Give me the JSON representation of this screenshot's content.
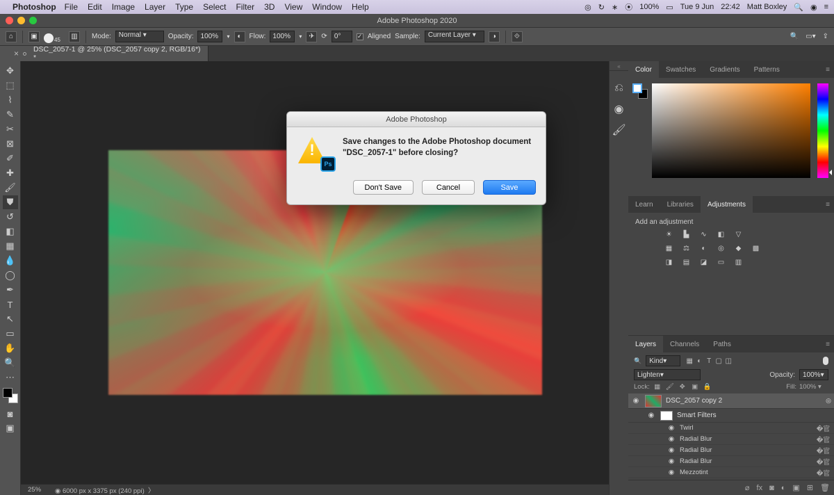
{
  "menubar": {
    "app_name": "Photoshop",
    "items": [
      "File",
      "Edit",
      "Image",
      "Layer",
      "Type",
      "Select",
      "Filter",
      "3D",
      "View",
      "Window",
      "Help"
    ],
    "status": {
      "battery": "100%",
      "date": "Tue 9 Jun",
      "time": "22:42",
      "user": "Matt Boxley"
    }
  },
  "window_title": "Adobe Photoshop 2020",
  "options": {
    "brush_size": "45",
    "mode_label": "Mode:",
    "mode": "Normal",
    "opacity_label": "Opacity:",
    "opacity": "100%",
    "flow_label": "Flow:",
    "flow": "100%",
    "angle_icon": "⟳",
    "angle": "0°",
    "aligned_label": "Aligned",
    "sample_label": "Sample:",
    "sample": "Current Layer"
  },
  "doc_tab": "DSC_2057-1 @ 25% (DSC_2057 copy 2, RGB/16*) *",
  "statusbar": {
    "zoom": "25%",
    "info": "6000 px x 3375 px (240 ppi)"
  },
  "panels": {
    "color_tabs": [
      "Color",
      "Swatches",
      "Gradients",
      "Patterns"
    ],
    "adjust_tabs": [
      "Learn",
      "Libraries",
      "Adjustments"
    ],
    "adjust_hint": "Add an adjustment",
    "layers_tabs": [
      "Layers",
      "Channels",
      "Paths"
    ]
  },
  "layers": {
    "kind": "Kind",
    "blend": "Lighten",
    "opacity_label": "Opacity:",
    "opacity": "100%",
    "lock_label": "Lock:",
    "fill_label": "Fill:",
    "fill": "100%",
    "layer_name": "DSC_2057 copy 2",
    "smart_label": "Smart Filters",
    "filters": [
      "Twirl",
      "Radial Blur",
      "Radial Blur",
      "Radial Blur",
      "Mezzotint"
    ]
  },
  "dialog": {
    "title": "Adobe Photoshop",
    "message": "Save changes to the Adobe Photoshop document \"DSC_2057-1\" before closing?",
    "dont_save": "Don't Save",
    "cancel": "Cancel",
    "save": "Save"
  }
}
